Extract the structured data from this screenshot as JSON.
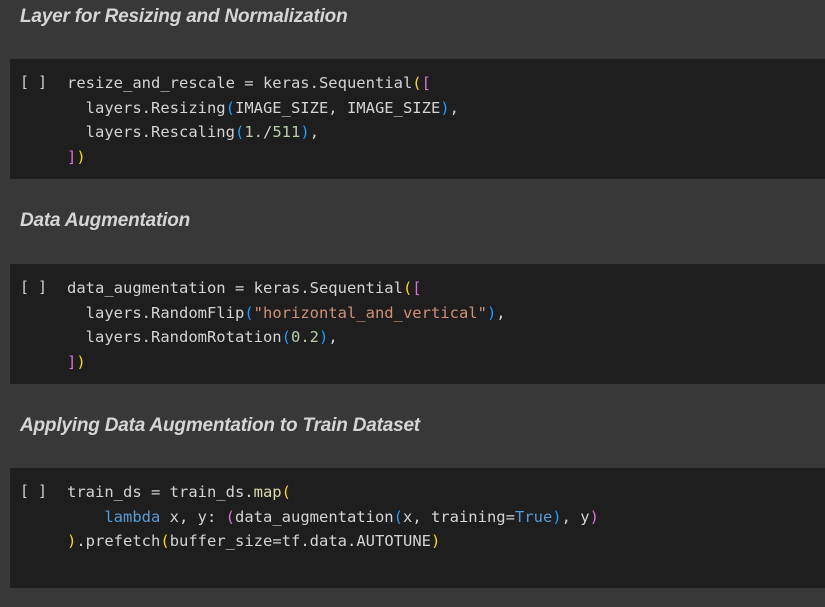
{
  "sections": [
    {
      "heading": "Layer for Resizing and Normalization",
      "run_label": "[ ]",
      "code": [
        [
          {
            "t": "resize_and_rescale = keras.Sequential"
          },
          {
            "t": "(",
            "c": "br1"
          },
          {
            "t": "[",
            "c": "br2"
          }
        ],
        [
          {
            "t": "  layers.Resizing"
          },
          {
            "t": "(",
            "c": "br3"
          },
          {
            "t": "IMAGE_SIZE, IMAGE_SIZE"
          },
          {
            "t": ")",
            "c": "br3"
          },
          {
            "t": ","
          }
        ],
        [
          {
            "t": "  layers.Rescaling"
          },
          {
            "t": "(",
            "c": "br3"
          },
          {
            "t": "1.",
            "c": "num"
          },
          {
            "t": "/"
          },
          {
            "t": "511",
            "c": "num"
          },
          {
            "t": ")",
            "c": "br3"
          },
          {
            "t": ","
          }
        ],
        [
          {
            "t": "]",
            "c": "br2"
          },
          {
            "t": ")",
            "c": "br1"
          }
        ]
      ]
    },
    {
      "heading": "Data Augmentation",
      "run_label": "[ ]",
      "code": [
        [
          {
            "t": "data_augmentation = keras.Sequential"
          },
          {
            "t": "(",
            "c": "br1"
          },
          {
            "t": "[",
            "c": "br2"
          }
        ],
        [
          {
            "t": "  layers.RandomFlip"
          },
          {
            "t": "(",
            "c": "br3"
          },
          {
            "t": "\"horizontal_and_vertical\"",
            "c": "str"
          },
          {
            "t": ")",
            "c": "br3"
          },
          {
            "t": ","
          }
        ],
        [
          {
            "t": "  layers.RandomRotation"
          },
          {
            "t": "(",
            "c": "br3"
          },
          {
            "t": "0.2",
            "c": "num"
          },
          {
            "t": ")",
            "c": "br3"
          },
          {
            "t": ","
          }
        ],
        [
          {
            "t": "]",
            "c": "br2"
          },
          {
            "t": ")",
            "c": "br1"
          }
        ]
      ]
    },
    {
      "heading": "Applying Data Augmentation to Train Dataset",
      "run_label": "[ ]",
      "code": [
        [
          {
            "t": "train_ds = train_ds."
          },
          {
            "t": "map",
            "c": "fn"
          },
          {
            "t": "(",
            "c": "br1"
          }
        ],
        [
          {
            "t": "    "
          },
          {
            "t": "lambda",
            "c": "kw"
          },
          {
            "t": " x, y: "
          },
          {
            "t": "(",
            "c": "br2"
          },
          {
            "t": "data_augmentation"
          },
          {
            "t": "(",
            "c": "br3"
          },
          {
            "t": "x, training="
          },
          {
            "t": "True",
            "c": "kw"
          },
          {
            "t": ")",
            "c": "br3"
          },
          {
            "t": ", y"
          },
          {
            "t": ")",
            "c": "br2"
          }
        ],
        [
          {
            "t": ")",
            "c": "br1"
          },
          {
            "t": ".prefetch"
          },
          {
            "t": "(",
            "c": "br1"
          },
          {
            "t": "buffer_size=tf.data.AUTOTUNE"
          },
          {
            "t": ")",
            "c": "br1"
          }
        ]
      ]
    }
  ]
}
